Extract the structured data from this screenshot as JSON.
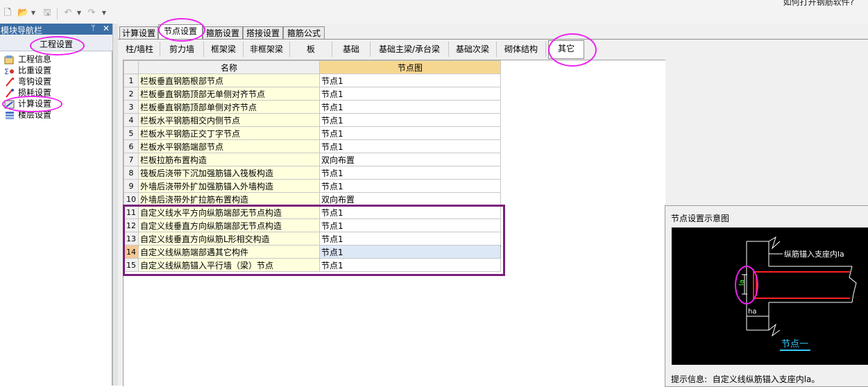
{
  "toolbar": {
    "icons": [
      "new-file-icon",
      "open-folder-icon",
      "dropdown-arrow-icon",
      "save-icon",
      "undo-icon",
      "dropdown-arrow-icon",
      "redo-icon",
      "dropdown-arrow-icon"
    ],
    "help_link": "如何打开钢筋软件?"
  },
  "nav": {
    "title": "模块导航栏",
    "pin_glyph": "ᛘ",
    "close_glyph": "✕",
    "group_label": "工程设置",
    "items": [
      {
        "label": "工程信息",
        "icon": "project-info-icon"
      },
      {
        "label": "比重设置",
        "icon": "weight-settings-icon"
      },
      {
        "label": "弯钩设置",
        "icon": "hook-settings-icon"
      },
      {
        "label": "损耗设置",
        "icon": "loss-settings-icon"
      },
      {
        "label": "计算设置",
        "icon": "calc-settings-icon"
      },
      {
        "label": "楼层设置",
        "icon": "floor-settings-icon"
      }
    ]
  },
  "tabs_top": [
    "计算设置",
    "节点设置",
    "箍筋设置",
    "搭接设置",
    "箍筋公式"
  ],
  "tabs_top_active": "节点设置",
  "tabs_sub": [
    "柱/墙柱",
    "剪力墙",
    "框架梁",
    "非框架梁",
    "板",
    "基础",
    "基础主梁/承台梁",
    "基础次梁",
    "砌体结构",
    "其它"
  ],
  "tabs_sub_active": "其它",
  "grid": {
    "col_name": "名称",
    "col_node": "节点图",
    "rows": [
      {
        "n": "1",
        "name": "栏板垂直钢筋根部节点",
        "value": "节点1"
      },
      {
        "n": "2",
        "name": "栏板垂直钢筋顶部无单侧对齐节点",
        "value": "节点1"
      },
      {
        "n": "3",
        "name": "栏板垂直钢筋顶部单侧对齐节点",
        "value": "节点1"
      },
      {
        "n": "4",
        "name": "栏板水平钢筋相交内侧节点",
        "value": "节点1"
      },
      {
        "n": "5",
        "name": "栏板水平钢筋正交丁字节点",
        "value": "节点1"
      },
      {
        "n": "6",
        "name": "栏板水平钢筋端部节点",
        "value": "节点1"
      },
      {
        "n": "7",
        "name": "栏板拉筋布置构造",
        "value": "双向布置"
      },
      {
        "n": "8",
        "name": "筏板后浇带下沉加强筋锚入筏板构造",
        "value": "节点1"
      },
      {
        "n": "9",
        "name": "外墙后浇带外扩加强筋锚入外墙构造",
        "value": "节点1"
      },
      {
        "n": "10",
        "name": "外墙后浇带外扩拉筋布置构造",
        "value": "双向布置"
      },
      {
        "n": "11",
        "name": "自定义线水平方向纵筋端部无节点构造",
        "value": "节点1"
      },
      {
        "n": "12",
        "name": "自定义线垂直方向纵筋端部无节点构造",
        "value": "节点1"
      },
      {
        "n": "13",
        "name": "自定义线垂直方向纵筋L形相交构造",
        "value": "节点1"
      },
      {
        "n": "14",
        "name": "自定义线纵筋端部遇其它构件",
        "value": "节点1"
      },
      {
        "n": "15",
        "name": "自定义线纵筋锚入平行墙（梁）节点",
        "value": "节点1"
      }
    ],
    "selected_row": 14
  },
  "preview": {
    "title": "节点设置示意图",
    "label_anchor": "纵筋锚入支座内la",
    "label_la": "la",
    "label_ha": "ha",
    "caption": "节点一",
    "tip_label": "提示信息:",
    "tip_text": "自定义线纵筋锚入支座内la。",
    "colors": {
      "rebar": "#ff2020",
      "text_green": "#3cff3c",
      "caption": "#33ccff",
      "lines": "#ffffff"
    }
  }
}
